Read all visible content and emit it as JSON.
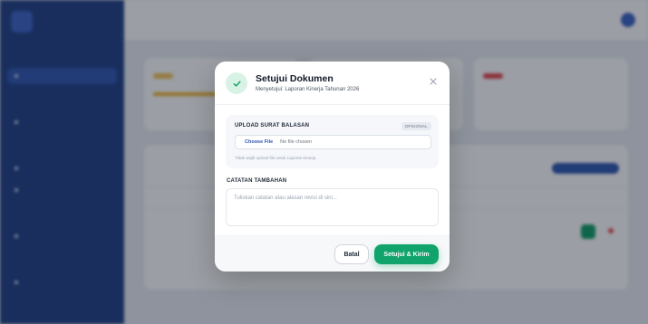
{
  "modal": {
    "title": "Setujui Dokumen",
    "subtitle": "Menyetujui: Laporan Kinerja Tahunan 2026",
    "upload": {
      "label": "UPLOAD SURAT BALASAN",
      "badge": "OPSIONAL",
      "choose_file_label": "Choose File",
      "no_file_text": "No file chosen",
      "hint": "Tidak wajib upload file untuk Laporan Kinerja"
    },
    "notes": {
      "label": "CATATAN TAMBAHAN",
      "placeholder": "Tuliskan catatan atau alasan revisi di sini...",
      "value": ""
    },
    "buttons": {
      "cancel": "Batal",
      "approve": "Setujui & Kirim"
    }
  },
  "colors": {
    "primary_green": "#10a36b",
    "sidebar_blue": "#1f3f86",
    "link_blue": "#2e56b0"
  },
  "icons": {
    "header_status": "check-icon",
    "close": "close-icon"
  }
}
